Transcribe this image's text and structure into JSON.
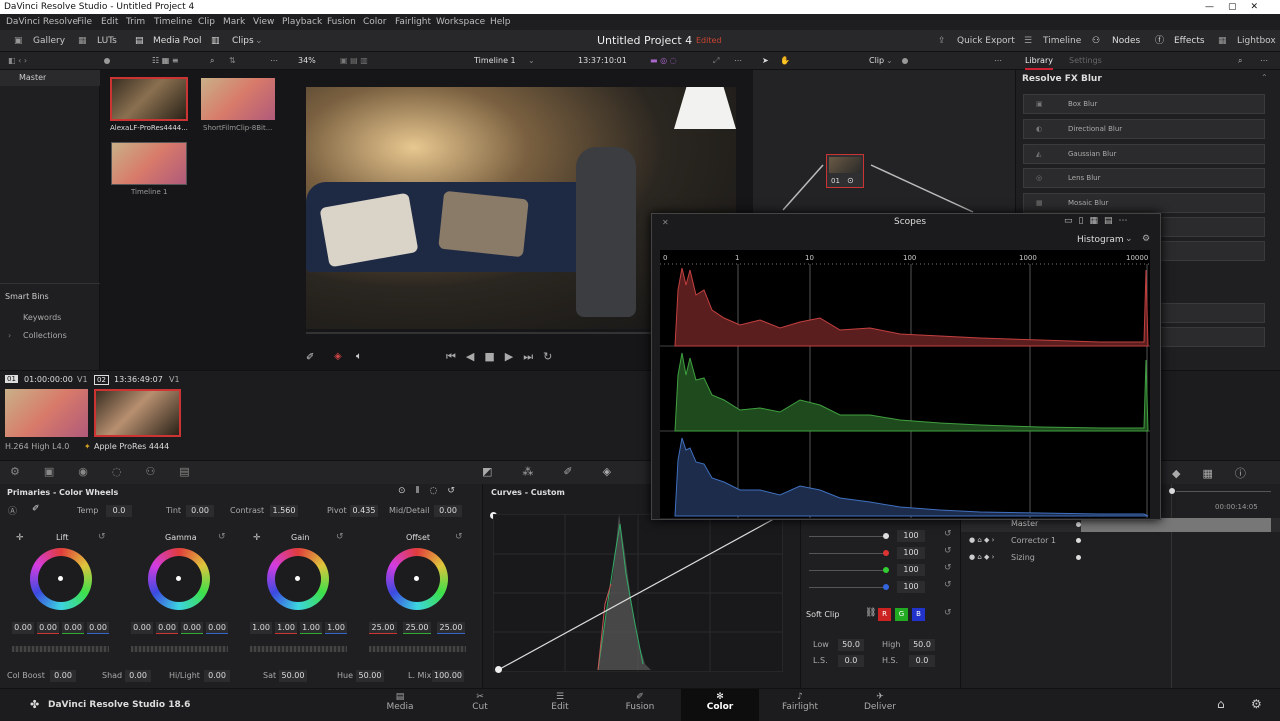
{
  "window_title": "DaVinci Resolve Studio - Untitled Project 4",
  "menu": [
    "DaVinci Resolve",
    "File",
    "Edit",
    "Trim",
    "Timeline",
    "Clip",
    "Mark",
    "View",
    "Playback",
    "Fusion",
    "Color",
    "Fairlight",
    "Workspace",
    "Help"
  ],
  "toolbar": {
    "gallery": "Gallery",
    "luts": "LUTs",
    "media_pool": "Media Pool",
    "clips": "Clips",
    "project": "Untitled Project 4",
    "status": "Edited",
    "quick_export": "Quick Export",
    "timeline": "Timeline",
    "nodes": "Nodes",
    "effects": "Effects",
    "lightbox": "Lightbox"
  },
  "viewer": {
    "zoom": "34%",
    "timeline_name": "Timeline 1",
    "timecode": "13:37:10:01",
    "clip_mode": "Clip"
  },
  "library": {
    "tab_library": "Library",
    "tab_settings": "Settings",
    "section": "Resolve FX Blur",
    "items": [
      "Box Blur",
      "Directional Blur",
      "Gaussian Blur",
      "Lens Blur",
      "Mosaic Blur"
    ]
  },
  "media": {
    "bin": "Master",
    "clips": [
      "AlexaLF-ProRes4444...",
      "ShortFilmClip-8Bit...",
      "Timeline 1"
    ],
    "smart_bins": "Smart Bins",
    "keywords": "Keywords",
    "collections": "Collections"
  },
  "clip_strip": {
    "c1_num": "01",
    "c1_tc": "01:00:00:00",
    "c1_track": "V1",
    "c1_codec": "H.264 High L4.0",
    "c2_num": "02",
    "c2_tc": "13:36:49:07",
    "c2_track": "V1",
    "c2_codec": "Apple ProRes 4444"
  },
  "primaries": {
    "title": "Primaries - Color Wheels",
    "temp_l": "Temp",
    "temp": "0.0",
    "tint_l": "Tint",
    "tint": "0.00",
    "contrast_l": "Contrast",
    "contrast": "1.560",
    "pivot_l": "Pivot",
    "pivot": "0.435",
    "md_l": "Mid/Detail",
    "md": "0.00",
    "wheels": [
      {
        "name": "Lift",
        "vals": [
          "0.00",
          "0.00",
          "0.00",
          "0.00"
        ]
      },
      {
        "name": "Gamma",
        "vals": [
          "0.00",
          "0.00",
          "0.00",
          "0.00"
        ]
      },
      {
        "name": "Gain",
        "vals": [
          "1.00",
          "1.00",
          "1.00",
          "1.00"
        ]
      },
      {
        "name": "Offset",
        "vals": [
          "25.00",
          "25.00",
          "25.00"
        ]
      }
    ],
    "colboost_l": "Col Boost",
    "colboost": "0.00",
    "shad_l": "Shad",
    "shad": "0.00",
    "hilight_l": "Hi/Light",
    "hilight": "0.00",
    "sat_l": "Sat",
    "sat": "50.00",
    "hue_l": "Hue",
    "hue": "50.00",
    "lmix_l": "L. Mix",
    "lmix": "100.00"
  },
  "curves": {
    "title": "Curves - Custom"
  },
  "curve_vals": [
    "100",
    "100",
    "100",
    "100"
  ],
  "softclip": {
    "title": "Soft Clip",
    "low_l": "Low",
    "low": "50.0",
    "high_l": "High",
    "high": "50.0",
    "ls_l": "L.S.",
    "ls": "0.0",
    "hs_l": "H.S.",
    "hs": "0.0",
    "r": "R",
    "g": "G",
    "b": "B"
  },
  "keyframes": {
    "master": "Master",
    "corrector": "Corrector 1",
    "sizing": "Sizing",
    "tc": "00:00:14:05"
  },
  "node_label": "01",
  "scopes": {
    "title": "Scopes",
    "mode": "Histogram",
    "ticks": [
      "0",
      "1",
      "10",
      "100",
      "1000",
      "10000"
    ]
  },
  "footer": {
    "brand": "DaVinci Resolve Studio 18.6",
    "pages": [
      "Media",
      "Cut",
      "Edit",
      "Fusion",
      "Color",
      "Fairlight",
      "Deliver"
    ],
    "active": "Color"
  }
}
